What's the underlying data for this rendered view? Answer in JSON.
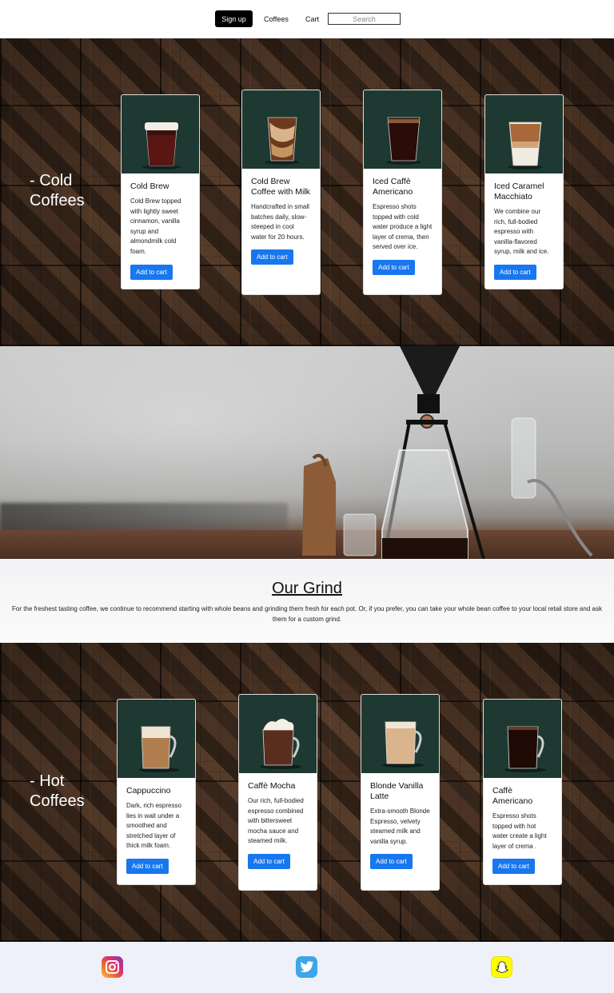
{
  "nav": {
    "signup": "Sign up",
    "coffees": "Coffees",
    "cart": "Cart",
    "search_placeholder": "Search"
  },
  "cold": {
    "title_line1": "- Cold",
    "title_line2": "Coffees",
    "items": [
      {
        "name": "Cold Brew",
        "desc": "Cold Brew topped with lightly sweet cinnamon, vanilla syrup and almondmilk cold foam.",
        "button": "Add to cart"
      },
      {
        "name": "Cold Brew Coffee with Milk",
        "desc": "Handcrafted in small batches daily, slow-steeped in cool water for 20 hours.",
        "button": "Add to cart"
      },
      {
        "name": "Iced Caffè Americano",
        "desc": "Espresso shots topped with cold water produce a light layer of crema, then served over ice.",
        "button": "Add to cart"
      },
      {
        "name": "Iced Caramel Macchiato",
        "desc": "We combine our rich, full-bodied espresso with vanilla-flavored syrup, milk and ice.",
        "button": "Add to cart"
      }
    ]
  },
  "grind": {
    "title": "Our Grind",
    "text": "For the freshest tasting coffee, we continue to recommend starting with whole beans and grinding them fresh for each pot. Or, if you prefer, you can take your whole bean coffee to your local retail store and ask them for a custom grind."
  },
  "hot": {
    "title_line1": "- Hot",
    "title_line2": "Coffees",
    "items": [
      {
        "name": "Cappuccino",
        "desc": "Dark, rich espresso lies in wait under a smoothed and stretched layer of thick milk foam.",
        "button": "Add to cart"
      },
      {
        "name": "Caffè Mocha",
        "desc": "Our rich, full-bodied espresso combined with bittersweet mocha sauce and steamed milk.",
        "button": "Add to cart"
      },
      {
        "name": "Blonde Vanilla Latte",
        "desc": "Extra-smooth Blonde Espresso, velvety steamed milk and vanilla syrup.",
        "button": "Add to cart"
      },
      {
        "name": "Caffè Americano",
        "desc": "Espresso shots topped with hot water create a light layer of crema .",
        "button": "Add to cart"
      }
    ]
  },
  "footer": {
    "icons": [
      "instagram-icon",
      "twitter-icon",
      "snapchat-icon"
    ]
  },
  "colors": {
    "card_image_bg": "#1e3932",
    "button": "#1877ee",
    "footer_bg": "#eef1fa"
  }
}
